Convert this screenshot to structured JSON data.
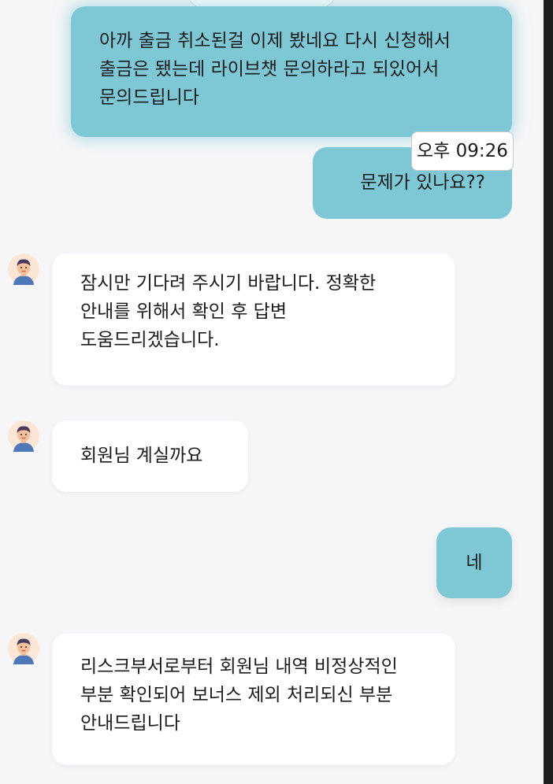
{
  "messages": [
    {
      "direction": "out",
      "text": "아까 출금 취소된걸 이제 봤네요 다시 신청해서 출금은 됐는데 라이브챗 문의하라고 되있어서 문의드립니다"
    },
    {
      "direction": "out",
      "text": "문제가 있나요??",
      "time": "오후 09:26"
    },
    {
      "direction": "in",
      "avatar_icon": "agent-avatar-icon",
      "text": "잠시만 기다려 주시기 바랍니다. 정확한 안내를 위해서 확인 후 답변 도움드리겠습니다."
    },
    {
      "direction": "in",
      "avatar_icon": "agent-avatar-icon",
      "text": "회원님 계실까요"
    },
    {
      "direction": "out",
      "text": "네"
    },
    {
      "direction": "in",
      "avatar_icon": "agent-avatar-icon",
      "text": "리스크부서로부터 회원님 내역 비정상적인 부분 확인되어 보너스 제외 처리되신 부분 안내드립니다"
    }
  ],
  "colors": {
    "outgoing_bubble": "#7ec8d6",
    "incoming_bubble": "#ffffff",
    "background": "#f6f6f8"
  }
}
